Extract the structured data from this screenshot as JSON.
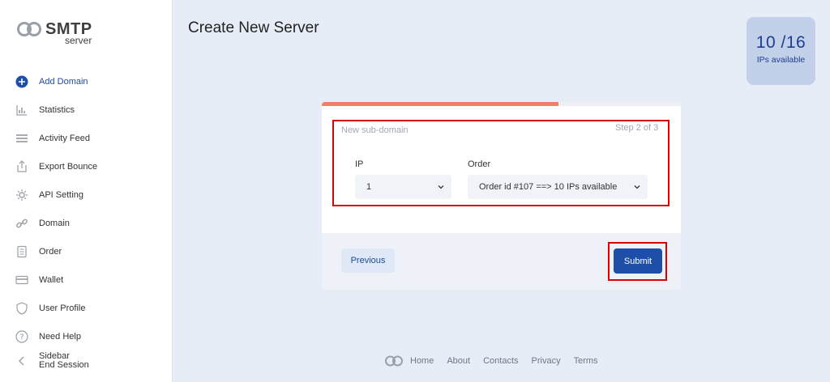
{
  "app": {
    "logo_primary": "SMTP",
    "logo_secondary": "server"
  },
  "sidebar": {
    "items": [
      {
        "label": "Add Domain",
        "icon": "plus-circle-icon",
        "active": true
      },
      {
        "label": "Statistics",
        "icon": "bar-chart-icon"
      },
      {
        "label": "Activity Feed",
        "icon": "list-icon"
      },
      {
        "label": "Export Bounce",
        "icon": "export-icon"
      },
      {
        "label": "API Setting",
        "icon": "gear-icon"
      },
      {
        "label": "Domain",
        "icon": "link-icon"
      },
      {
        "label": "Order",
        "icon": "document-icon"
      },
      {
        "label": "Wallet",
        "icon": "wallet-icon"
      },
      {
        "label": "User Profile",
        "icon": "user-shield-icon"
      },
      {
        "label": "Need Help",
        "icon": "help-icon"
      }
    ],
    "toggle_label": "Sidebar",
    "end_session_label": "End Session"
  },
  "main": {
    "title": "Create New Server"
  },
  "ip_badge": {
    "count": "10 /16",
    "label": "IPs available"
  },
  "form": {
    "progress": 0.66,
    "section_title": "New sub-domain",
    "step": "Step 2 of 3",
    "ip_label": "IP",
    "ip_value": "1",
    "order_label": "Order",
    "order_value": "Order id #107 ==> 10 IPs available",
    "previous_label": "Previous",
    "submit_label": "Submit"
  },
  "footer": {
    "links": [
      "Home",
      "About",
      "Contacts",
      "Privacy",
      "Terms"
    ]
  },
  "colors": {
    "accent": "#1d4fa8",
    "progress": "#ee8068",
    "highlight": "#dd0000",
    "background": "#e7edf6"
  }
}
